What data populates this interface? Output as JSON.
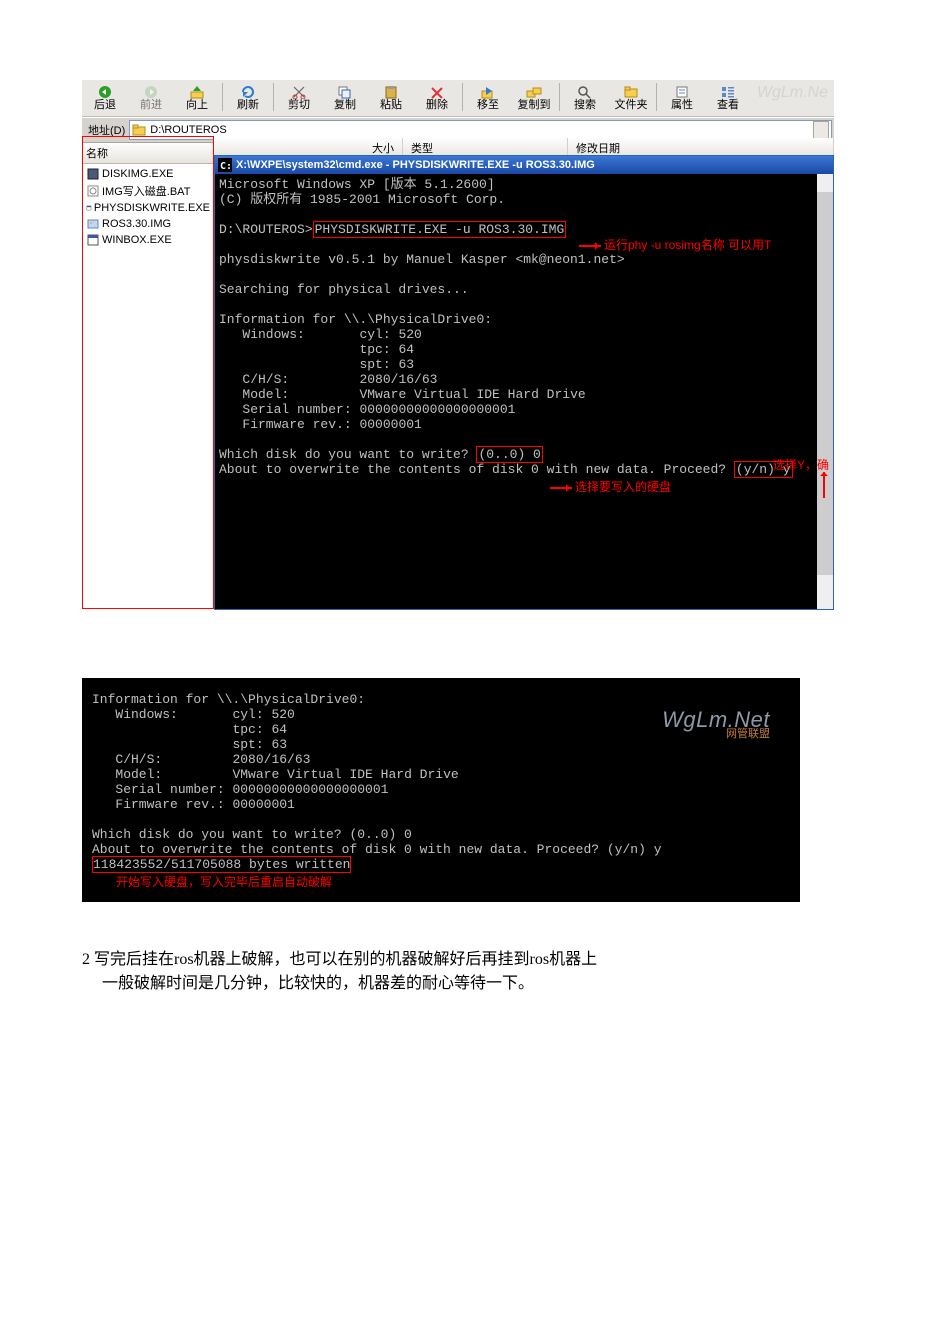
{
  "explorer": {
    "toolbar": {
      "back": "后退",
      "forward": "前进",
      "up": "向上",
      "refresh": "刷新",
      "cut": "剪切",
      "copy": "复制",
      "paste": "粘贴",
      "delete": "删除",
      "moveTo": "移至",
      "copyTo": "复制到",
      "search": "搜索",
      "folders": "文件夹",
      "properties": "属性",
      "views": "查看"
    },
    "addressLabel": "地址(D)",
    "addressValue": "D:\\ROUTEROS",
    "listHeader": "名称",
    "colSize": "大小",
    "colType": "类型",
    "colDate": "修改日期",
    "files": [
      "DISKIMG.EXE",
      "IMG写入磁盘.BAT",
      "PHYSDISKWRITE.EXE",
      "ROS3.30.IMG",
      "WINBOX.EXE"
    ]
  },
  "cmd1": {
    "title": "X:\\WXPE\\system32\\cmd.exe - PHYSDISKWRITE.EXE -u ROS3.30.IMG",
    "l1": "Microsoft Windows XP [版本 5.1.2600]",
    "l2": "(C) 版权所有 1985-2001 Microsoft Corp.",
    "promptPath": "D:\\ROUTEROS>",
    "promptCmd": "PHYSDISKWRITE.EXE -u ROS3.30.IMG",
    "ver": "physdiskwrite v0.5.1 by Manuel Kasper <mk@neon1.net>",
    "search": "Searching for physical drives...",
    "infoHdr": "Information for \\\\.\\PhysicalDrive0:",
    "winLbl": "   Windows:",
    "cyl": "cyl: 520",
    "tpc": "tpc: 64",
    "spt": "spt: 63",
    "chsLbl": "   C/H/S:",
    "chsVal": "2080/16/63",
    "modelLbl": "   Model:",
    "modelVal": "VMware Virtual IDE Hard Drive",
    "serialLbl": "   Serial number:",
    "serialVal": "00000000000000000001",
    "fwLbl": "   Firmware rev.:",
    "fwVal": "00000001",
    "whichPre": "Which disk do you want to write? ",
    "whichBox": "(0..0) 0",
    "aboutPre": "About to overwrite the contents of disk 0 with new data. Proceed? ",
    "aboutBox": "(y/n) y",
    "anno_run": "运行phy -u rosimg名称 可以用T",
    "anno_disk": "选择要写入的硬盘",
    "anno_y": "选择Y，确"
  },
  "cmd2": {
    "infoHdr": "Information for \\\\.\\PhysicalDrive0:",
    "cyl": "cyl: 520",
    "tpc": "tpc: 64",
    "spt": "spt: 63",
    "chsVal": "2080/16/63",
    "modelVal": "VMware Virtual IDE Hard Drive",
    "serialVal": "00000000000000000001",
    "fwVal": "00000001",
    "which": "Which disk do you want to write? (0..0) 0",
    "about": "About to overwrite the contents of disk 0 with new data. Proceed? (y/n) y",
    "bytes": "118423552/511705088 bytes written",
    "anno": "开始写入硬盘，写入完毕后重启自动破解",
    "wmBig": "WgLm.Net",
    "wmSm": "网管联盟"
  },
  "body": {
    "p1": "2 写完后挂在ros机器上破解，也可以在别的机器破解好后再挂到ros机器上",
    "p2": "一般破解时间是几分钟，比较快的，机器差的耐心等待一下。"
  },
  "watermark": "WgLm.Ne"
}
